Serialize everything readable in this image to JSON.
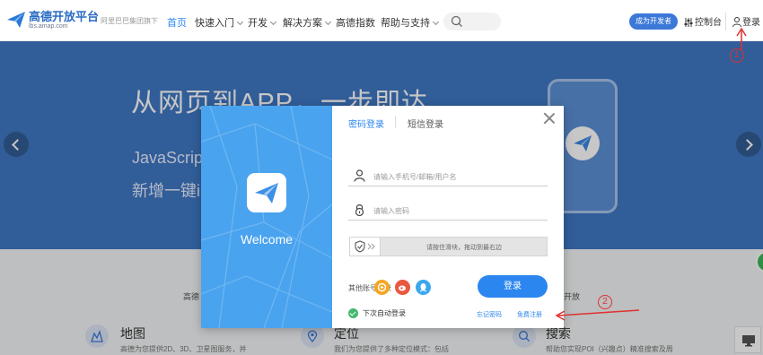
{
  "header": {
    "logo_name": "高德开放平台",
    "logo_domain": "lbs.amap.com",
    "slogan": "阿里巴巴集团旗下",
    "nav": [
      {
        "label": "首页",
        "active": true
      },
      {
        "label": "快速入门",
        "dropdown": true
      },
      {
        "label": "开发",
        "dropdown": true
      },
      {
        "label": "解决方案",
        "dropdown": true
      },
      {
        "label": "高德指数"
      },
      {
        "label": "帮助与支持",
        "dropdown": true
      }
    ],
    "developer_button": "成为开发者",
    "console_label": "控制台",
    "login_label": "登录"
  },
  "banner": {
    "title": "从网页到APP，一步即达",
    "line1": "JavaScrip",
    "line2": "新增一键i"
  },
  "below": {
    "left_label": "高德",
    "right_label": "开放",
    "features": [
      {
        "title": "地图",
        "desc": "高德为您提供2D、3D、卫星图服务，并",
        "icon": "map-icon"
      },
      {
        "title": "定位",
        "desc": "我们为您提供了多种定位模式：包括",
        "icon": "location-icon"
      },
      {
        "title": "搜索",
        "desc": "帮助您实现POI（兴趣点）精准搜索及周",
        "icon": "search-icon"
      }
    ]
  },
  "modal": {
    "welcome": "Welcome",
    "tab_password": "密码登录",
    "tab_sms": "短信登录",
    "username_placeholder": "请输入手机号/邮箱/用户名",
    "password_placeholder": "请输入密码",
    "slider_text": "请按住滑块，拖动到最右边",
    "other_accounts_label": "其他账号登录",
    "social": [
      "weibo-alt-icon",
      "weibo-icon",
      "qq-icon"
    ],
    "login_button": "登录",
    "remember_label": "下次自动登录",
    "forgot_password": "忘记密码",
    "free_register": "免费注册",
    "accent_color": "#2b86f0",
    "panel_color": "#4aa3ee"
  },
  "annotations": {
    "marker1": "1",
    "marker2": "2"
  }
}
